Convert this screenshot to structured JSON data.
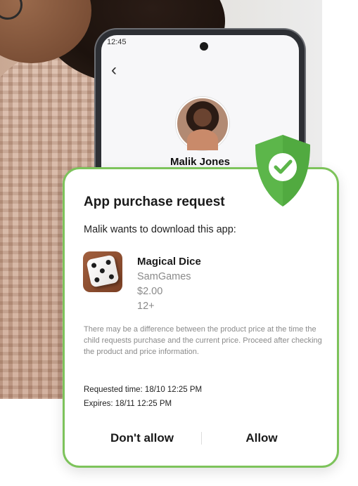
{
  "phone": {
    "status_time": "12:45",
    "back_icon": "chevron-left-icon",
    "child_name": "Malik Jones"
  },
  "shield": {
    "icon": "shield-check-icon",
    "color": "#5cb64a"
  },
  "request": {
    "title": "App purchase request",
    "subtitle": "Malik wants to download this app:",
    "app": {
      "name": "Magical Dice",
      "developer": "SamGames",
      "price": "$2.00",
      "age_rating": "12+",
      "icon": "dice-app-icon"
    },
    "notice": "There may be a difference between the product price at the time the child requests purchase and the current price. Proceed after checking the product and price information.",
    "requested_time": "Requested time: 18/10 12:25 PM",
    "expires": "Expires: 18/11 12:25 PM",
    "deny_label": "Don't allow",
    "allow_label": "Allow"
  },
  "colors": {
    "accent_green": "#7dc35b",
    "text_muted": "#8a8a8a"
  }
}
